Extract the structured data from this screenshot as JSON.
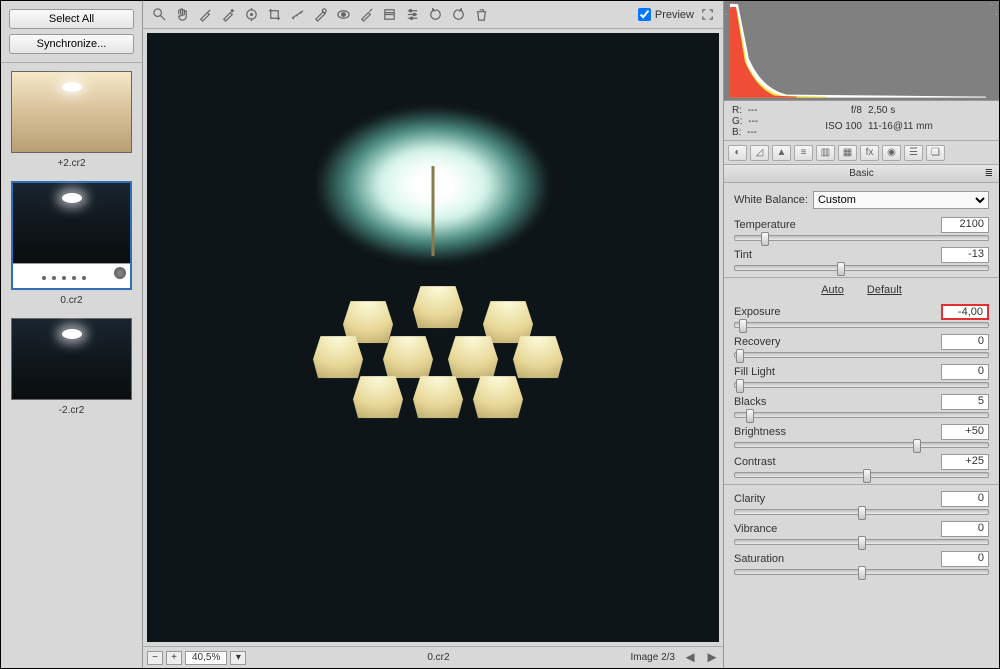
{
  "sidebar": {
    "buttons": {
      "select_all": "Select All",
      "synchronize": "Synchronize..."
    },
    "thumbnails": [
      {
        "label": "+2.cr2"
      },
      {
        "label": "0.cr2"
      },
      {
        "label": "-2.cr2"
      }
    ]
  },
  "toolbar": {
    "preview_label": "Preview"
  },
  "main": {
    "zoom": "40,5%",
    "filename": "0.cr2",
    "image_index": "Image 2/3"
  },
  "readout": {
    "r": "R:",
    "r_val": "---",
    "g": "G:",
    "g_val": "---",
    "b": "B:",
    "b_val": "---",
    "aperture": "f/8",
    "shutter": "2,50 s",
    "iso": "ISO 100",
    "lens": "11-16@11 mm"
  },
  "panel": {
    "title": "Basic",
    "wb_label": "White Balance:",
    "wb_value": "Custom",
    "auto": "Auto",
    "default": "Default",
    "sliders": {
      "temperature": {
        "label": "Temperature",
        "value": "2100",
        "pos": 12
      },
      "tint": {
        "label": "Tint",
        "value": "-13",
        "pos": 42
      },
      "exposure": {
        "label": "Exposure",
        "value": "-4,00",
        "pos": 3,
        "highlighted": true
      },
      "recovery": {
        "label": "Recovery",
        "value": "0",
        "pos": 2
      },
      "fill_light": {
        "label": "Fill Light",
        "value": "0",
        "pos": 2
      },
      "blacks": {
        "label": "Blacks",
        "value": "5",
        "pos": 6
      },
      "brightness": {
        "label": "Brightness",
        "value": "+50",
        "pos": 72
      },
      "contrast": {
        "label": "Contrast",
        "value": "+25",
        "pos": 52
      },
      "clarity": {
        "label": "Clarity",
        "value": "0",
        "pos": 50
      },
      "vibrance": {
        "label": "Vibrance",
        "value": "0",
        "pos": 50
      },
      "saturation": {
        "label": "Saturation",
        "value": "0",
        "pos": 50
      }
    }
  }
}
